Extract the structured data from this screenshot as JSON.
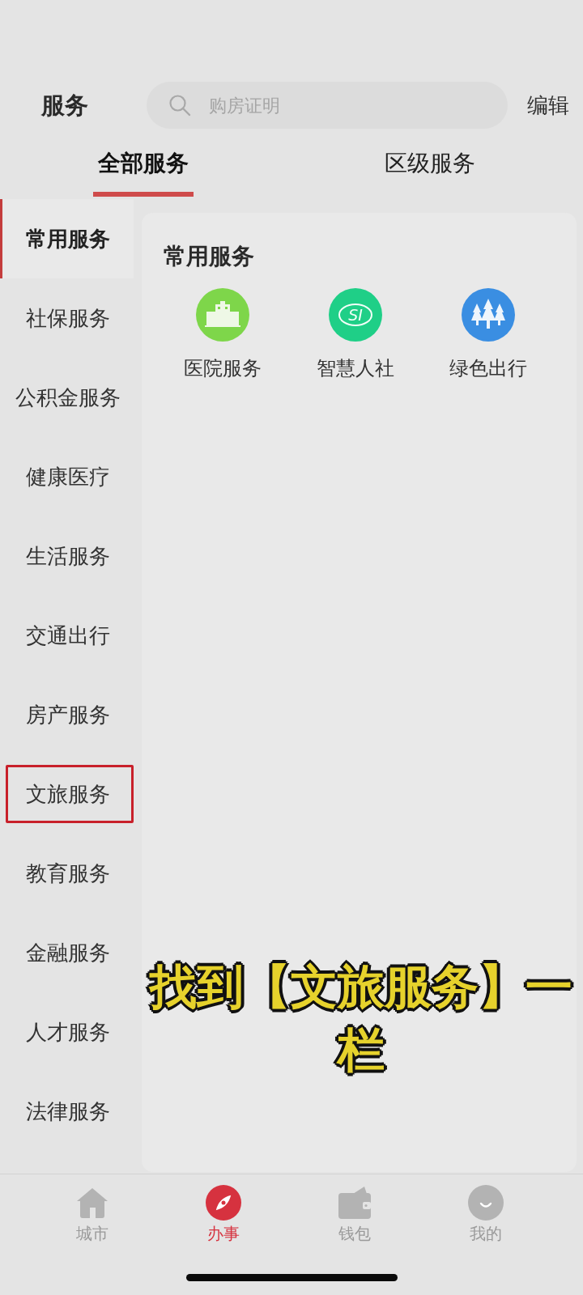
{
  "header": {
    "title": "服务",
    "search": {
      "placeholder": "购房证明"
    },
    "edit": "编辑"
  },
  "tabs": [
    {
      "label": "全部服务",
      "selected": true
    },
    {
      "label": "区级服务",
      "selected": false
    }
  ],
  "sidebar": [
    {
      "label": "常用服务",
      "selected": true,
      "outlined": false
    },
    {
      "label": "社保服务",
      "selected": false,
      "outlined": false
    },
    {
      "label": "公积金服务",
      "selected": false,
      "outlined": false
    },
    {
      "label": "健康医疗",
      "selected": false,
      "outlined": false
    },
    {
      "label": "生活服务",
      "selected": false,
      "outlined": false
    },
    {
      "label": "交通出行",
      "selected": false,
      "outlined": false
    },
    {
      "label": "房产服务",
      "selected": false,
      "outlined": false
    },
    {
      "label": "文旅服务",
      "selected": false,
      "outlined": true
    },
    {
      "label": "教育服务",
      "selected": false,
      "outlined": false
    },
    {
      "label": "金融服务",
      "selected": false,
      "outlined": false
    },
    {
      "label": "人才服务",
      "selected": false,
      "outlined": false
    },
    {
      "label": "法律服务",
      "selected": false,
      "outlined": false
    }
  ],
  "section": {
    "title": "常用服务",
    "services": [
      {
        "label": "医院服务",
        "kind": "building",
        "color": "#7ed64a"
      },
      {
        "label": "智慧人社",
        "kind": "logo",
        "logo_text": "SI",
        "color": "#1fcf87"
      },
      {
        "label": "绿色出行",
        "kind": "trees",
        "color": "#3a8ee2"
      }
    ]
  },
  "caption": "找到【文旅服务】一栏",
  "bottom_nav": [
    {
      "label": "城市",
      "kind": "house",
      "selected": false
    },
    {
      "label": "办事",
      "kind": "compass",
      "selected": true
    },
    {
      "label": "钱包",
      "kind": "wallet",
      "selected": false
    },
    {
      "label": "我的",
      "kind": "face",
      "selected": false
    }
  ]
}
